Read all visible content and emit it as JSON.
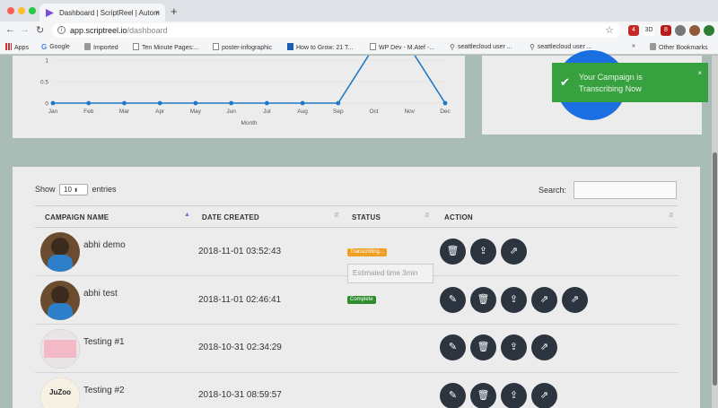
{
  "browser": {
    "tab_title": "Dashboard | ScriptReel | Autom",
    "url_domain": "app.scriptreel.io",
    "url_path": "/dashboard",
    "new_tab": "+",
    "close_tab": "×",
    "ext_labels": [
      "4",
      "3D",
      "8"
    ]
  },
  "bookmarks": {
    "items": [
      {
        "label": "Apps",
        "icon": "apps-grid-icon"
      },
      {
        "label": "Google",
        "icon": "google-icon"
      },
      {
        "label": "Imported",
        "icon": "folder-icon"
      },
      {
        "label": "Ten Minute Pages:...",
        "icon": "page-icon"
      },
      {
        "label": "poster-infographic",
        "icon": "page-icon"
      },
      {
        "label": "How to Grow: 21 T...",
        "icon": "medium-icon"
      },
      {
        "label": "WP Dev - M.Atef -...",
        "icon": "page-icon"
      },
      {
        "label": "seattlecloud user ...",
        "icon": "cloud-icon"
      },
      {
        "label": "seattlecloud user ...",
        "icon": "cloud-icon"
      }
    ],
    "more": "»",
    "other": "Other Bookmarks"
  },
  "chart_data": {
    "type": "line",
    "categories": [
      "Jan",
      "Feb",
      "Mar",
      "Apr",
      "May",
      "Jun",
      "Jul",
      "Aug",
      "Sep",
      "Oct",
      "Nov",
      "Dec"
    ],
    "values": [
      0,
      0,
      0,
      0,
      0,
      0,
      0,
      0,
      0,
      1.3,
      1.3,
      0
    ],
    "xlabel": "Month",
    "ylabel": "",
    "yticks": [
      "0",
      "0.5",
      "1"
    ],
    "ylim": [
      0,
      1
    ],
    "color": "#1f78c8"
  },
  "toast": {
    "message": "Your Campaign is Transcribing Now",
    "close": "×",
    "color": "#38a13f"
  },
  "table": {
    "show_label": "Show",
    "entries_value": "10",
    "entries_label": "entries",
    "search_label": "Search:",
    "headers": [
      "CAMPAIGN NAME",
      "DATE CREATED",
      "STATUS",
      "ACTION"
    ],
    "tooltip": "Estimated time 3min",
    "rows": [
      {
        "name": "abhi demo",
        "date": "2018-11-01 03:52:43",
        "status": "Transcribing...",
        "status_color": "#f0a020"
      },
      {
        "name": "abhi test",
        "date": "2018-11-01 02:46:41",
        "status": "Complete",
        "status_color": "#2e8b2e"
      },
      {
        "name": "Testing #1",
        "date": "2018-10-31 02:34:29",
        "status": "",
        "status_color": ""
      },
      {
        "name": "Testing #2",
        "date": "2018-10-31 08:59:57",
        "status": "",
        "status_color": ""
      }
    ],
    "thumb_text": "JuZoo"
  },
  "icons": {
    "edit": "✎",
    "delete": "🗑",
    "upload": "⇪",
    "share": "⇗",
    "sort": "⇵",
    "sort_asc": "▲"
  }
}
